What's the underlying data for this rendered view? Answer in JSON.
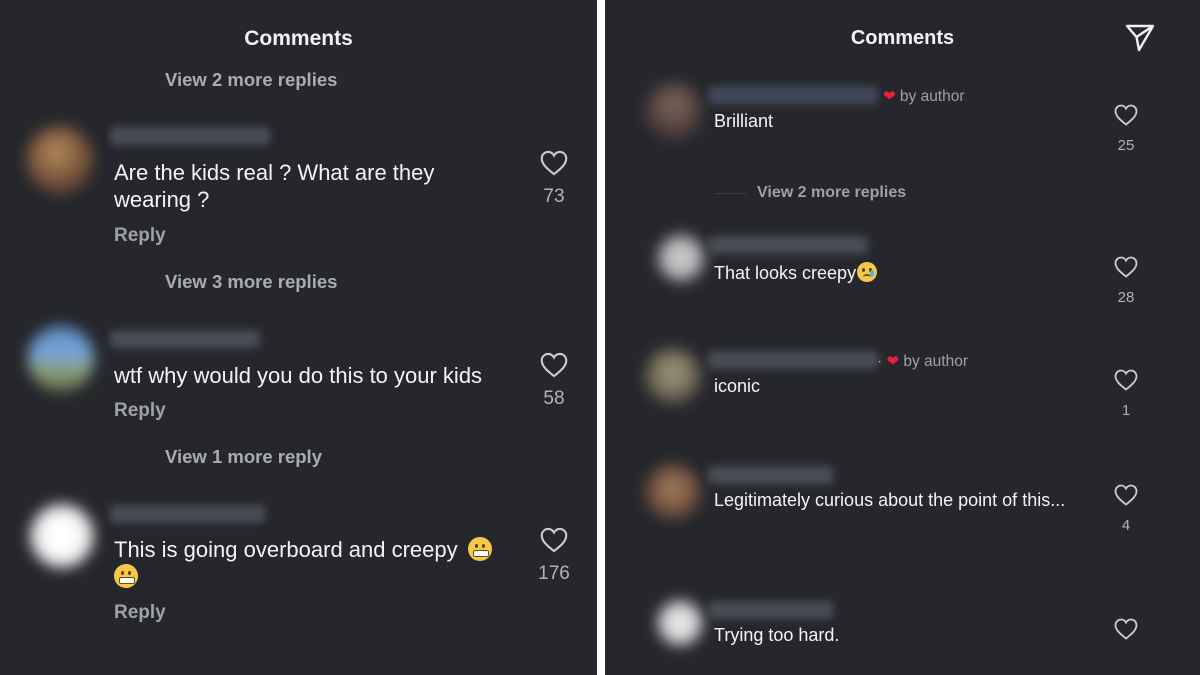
{
  "left": {
    "title": "Comments",
    "top_view_replies": "View 2 more replies",
    "comments": [
      {
        "text": "Are the kids real ? What are they wearing ?",
        "reply": "Reply",
        "likes": "73",
        "view_replies": "View 3 more replies"
      },
      {
        "text": "wtf why would you do this to your kids",
        "reply": "Reply",
        "likes": "58",
        "view_replies": "View 1 more reply"
      },
      {
        "text": "This is going overboard and creepy",
        "reply": "Reply",
        "likes": "176"
      }
    ]
  },
  "right": {
    "title": "Comments",
    "comments": [
      {
        "text": "Brilliant",
        "badge": "by author",
        "likes": "25"
      },
      {
        "text": "That looks creepy",
        "likes": "28"
      },
      {
        "text": "iconic",
        "badge": "by author",
        "likes": "1"
      },
      {
        "text": "Legitimately curious about the point of this...",
        "likes": "4"
      },
      {
        "text": "Trying too hard.",
        "likes": ""
      }
    ],
    "view_replies": "View 2 more replies"
  },
  "icons": {
    "like": "heart-outline-icon",
    "send": "paper-plane-icon",
    "author_like": "red-heart-icon",
    "emoji_grimace": "grimacing-face-emoji",
    "emoji_cry": "crying-face-emoji"
  },
  "colors": {
    "background": "#25272c",
    "text": "#f4f4f4",
    "muted": "#9ea1a7",
    "author_heart": "#e8213a"
  }
}
